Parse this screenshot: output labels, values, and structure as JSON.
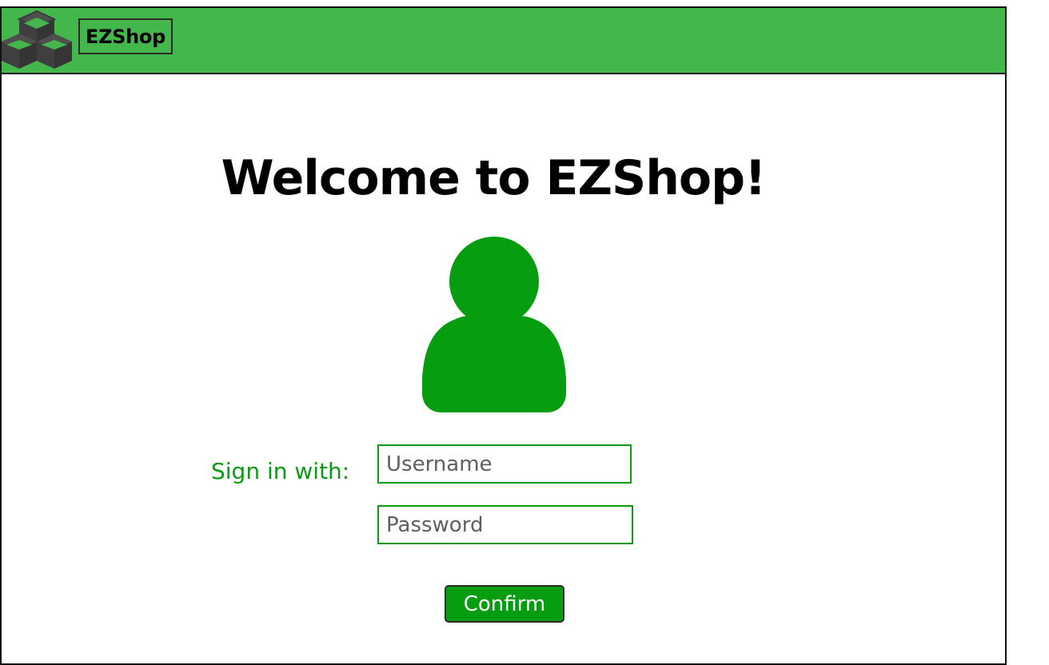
{
  "header": {
    "brand": "EZShop",
    "logo_icon": "stacked-cubes-icon",
    "bar_color": "#44b74c"
  },
  "main": {
    "title": "Welcome to EZShop!",
    "avatar_icon": "user-icon",
    "accent_color": "#079d10"
  },
  "login": {
    "signin_label": "Sign in with:",
    "username_placeholder": "Username",
    "username_value": "",
    "password_placeholder": "Password",
    "password_value": "",
    "confirm_label": "Confirm"
  }
}
